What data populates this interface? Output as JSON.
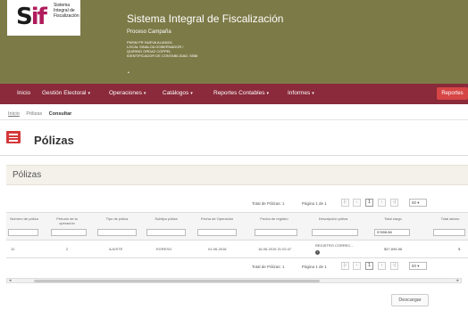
{
  "header": {
    "logo_text": "Sistema Integral de Fiscalización",
    "title": "Sistema Integral de Fiscalización",
    "subtitle": "Proceso Campaña",
    "info_lines": [
      "PMSM PR NUEVA ALIANZA",
      "LOCAL SINALOA GOBERNADOR /",
      "QUIRINO ORDAZ COPPEL",
      "IDENTIFICADOR DE CONTABILIDAD: 5558"
    ]
  },
  "nav": {
    "items": [
      "Inicio",
      "Gestión Electoral",
      "Operaciones",
      "Catálogos",
      "Reportes Contables",
      "Informes"
    ],
    "right_button": "Reportes"
  },
  "breadcrumb": {
    "inicio": "Inicio",
    "polizas": "Pólizas",
    "current": "Consultar"
  },
  "page": {
    "title": "Pólizas",
    "section_title": "Pólizas"
  },
  "pager": {
    "total": "Total de Pólizas: 1",
    "page": "Página 1 de 1",
    "current_page": "1",
    "page_size": "50"
  },
  "table": {
    "columns": [
      "Número de póliza",
      "Periodo de la operación",
      "Tipo de póliza",
      "Subtipo póliza",
      "Fecha de Operación",
      "Fecha de registro",
      "Descripción póliza",
      "Total cargo",
      "Total abono"
    ],
    "filter_total_cargo": "57898.88",
    "row": {
      "numero": "12",
      "periodo": "2",
      "tipo": "AJUSTE",
      "subtipo": "EGRESO",
      "fecha_operacion": "01-06-2016",
      "fecha_registro": "16-06-2016 21:02:47",
      "descripcion": "REGISTRO CORREC...",
      "total_cargo": "$57,898.88",
      "total_abono": "$"
    }
  },
  "actions": {
    "download": "Descargar"
  },
  "colors": {
    "header_bg": "#7c7a47",
    "nav_bg": "#8a2a3a",
    "accent_red": "#d43838"
  }
}
